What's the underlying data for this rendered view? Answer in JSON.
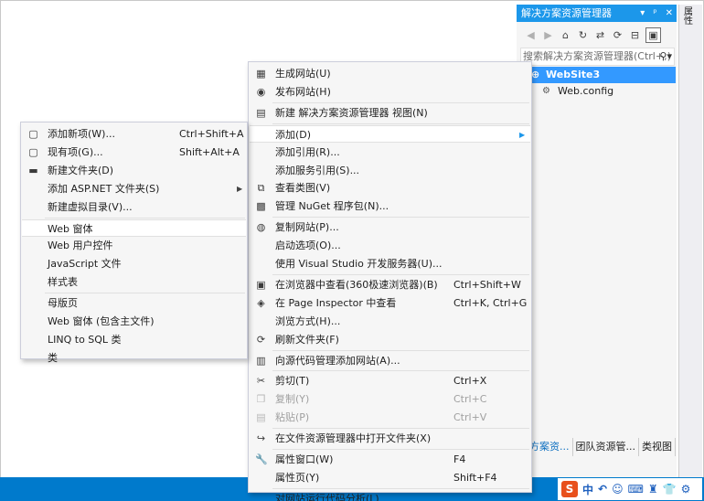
{
  "solution_explorer": {
    "title": "解决方案资源管理器",
    "title_buttons": [
      "▾",
      "ᵖ",
      "✕"
    ],
    "search_placeholder": "搜索解决方案资源管理器(Ctrl+;)",
    "tree": {
      "root": "WebSite3",
      "children": [
        "Web.config"
      ]
    },
    "bottom_tabs": [
      "决方案资...",
      "团队资源管...",
      "类视图"
    ]
  },
  "side_strip": {
    "label": "属性"
  },
  "main_menu": {
    "items": [
      {
        "label": "生成网站(U)",
        "icon": "build-icon",
        "shortcut": ""
      },
      {
        "label": "发布网站(H)",
        "icon": "publish-icon",
        "shortcut": ""
      },
      {
        "sep": true
      },
      {
        "label": "新建 解决方案资源管理器 视图(N)",
        "icon": "new-view-icon",
        "shortcut": ""
      },
      {
        "sep": true
      },
      {
        "label": "添加(D)",
        "icon": "",
        "shortcut": "",
        "submenu": true,
        "highlighted": true
      },
      {
        "label": "添加引用(R)...",
        "icon": "",
        "shortcut": ""
      },
      {
        "label": "添加服务引用(S)...",
        "icon": "",
        "shortcut": ""
      },
      {
        "label": "查看类图(V)",
        "icon": "class-diagram-icon",
        "shortcut": ""
      },
      {
        "label": "管理 NuGet 程序包(N)...",
        "icon": "nuget-icon",
        "shortcut": ""
      },
      {
        "sep": true
      },
      {
        "label": "复制网站(P)...",
        "icon": "copy-website-icon",
        "shortcut": ""
      },
      {
        "label": "启动选项(O)...",
        "icon": "",
        "shortcut": ""
      },
      {
        "label": "使用 Visual Studio 开发服务器(U)...",
        "icon": "",
        "shortcut": ""
      },
      {
        "sep": true
      },
      {
        "label": "在浏览器中查看(360极速浏览器)(B)",
        "icon": "browser-icon",
        "shortcut": "Ctrl+Shift+W"
      },
      {
        "label": "在 Page Inspector 中查看",
        "icon": "page-inspector-icon",
        "shortcut": "Ctrl+K, Ctrl+G"
      },
      {
        "label": "浏览方式(H)...",
        "icon": "",
        "shortcut": ""
      },
      {
        "label": "刷新文件夹(F)",
        "icon": "refresh-icon",
        "shortcut": ""
      },
      {
        "sep": true
      },
      {
        "label": "向源代码管理添加网站(A)...",
        "icon": "source-control-icon",
        "shortcut": ""
      },
      {
        "sep": true
      },
      {
        "label": "剪切(T)",
        "icon": "cut-icon",
        "shortcut": "Ctrl+X"
      },
      {
        "label": "复制(Y)",
        "icon": "copy-icon",
        "shortcut": "Ctrl+C",
        "disabled": true
      },
      {
        "label": "粘贴(P)",
        "icon": "paste-icon",
        "shortcut": "Ctrl+V",
        "disabled": true
      },
      {
        "sep": true
      },
      {
        "label": "在文件资源管理器中打开文件夹(X)",
        "icon": "open-folder-icon",
        "shortcut": ""
      },
      {
        "sep": true
      },
      {
        "label": "属性窗口(W)",
        "icon": "wrench-icon",
        "shortcut": "F4"
      },
      {
        "label": "属性页(Y)",
        "icon": "",
        "shortcut": "Shift+F4"
      },
      {
        "sep": true
      },
      {
        "label": "对网站运行代码分析(L)",
        "icon": "",
        "shortcut": ""
      }
    ]
  },
  "sub_menu": {
    "items": [
      {
        "label": "添加新项(W)...",
        "icon": "add-new-item-icon",
        "shortcut": "Ctrl+Shift+A"
      },
      {
        "label": "现有项(G)...",
        "icon": "existing-item-icon",
        "shortcut": "Shift+Alt+A"
      },
      {
        "label": "新建文件夹(D)",
        "icon": "new-folder-icon",
        "shortcut": ""
      },
      {
        "label": "添加 ASP.NET 文件夹(S)",
        "icon": "",
        "shortcut": "",
        "submenu": true
      },
      {
        "label": "新建虚拟目录(V)...",
        "icon": "",
        "shortcut": ""
      },
      {
        "sep": true
      },
      {
        "label": "Web 窗体",
        "icon": "",
        "shortcut": "",
        "highlighted": true
      },
      {
        "label": "Web 用户控件",
        "icon": "",
        "shortcut": ""
      },
      {
        "label": "JavaScript 文件",
        "icon": "",
        "shortcut": ""
      },
      {
        "label": "样式表",
        "icon": "",
        "shortcut": ""
      },
      {
        "sep": true
      },
      {
        "label": "母版页",
        "icon": "",
        "shortcut": ""
      },
      {
        "label": "Web 窗体 (包含主文件)",
        "icon": "",
        "shortcut": ""
      },
      {
        "label": "LINQ to SQL 类",
        "icon": "",
        "shortcut": ""
      },
      {
        "label": "类",
        "icon": "",
        "shortcut": ""
      }
    ]
  },
  "status_bar": {
    "ime_items": [
      "S",
      "中",
      "↶",
      "☺",
      "⌨",
      "♜",
      "👕",
      "⚙"
    ]
  },
  "colors": {
    "accent": "#1c97ea",
    "selection": "#3399ff",
    "status": "#007acc",
    "menu_bg": "#f6f6f6"
  }
}
